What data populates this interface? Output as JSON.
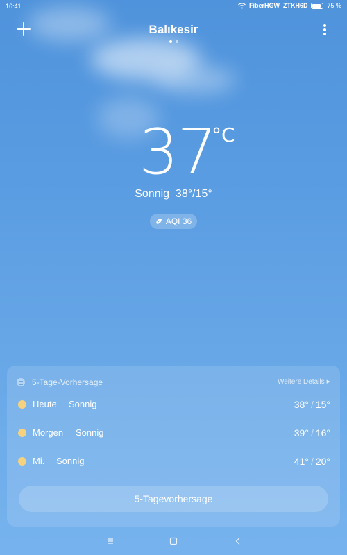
{
  "status_bar": {
    "time": "16:41",
    "network": "FiberHGW_ZTKH6D",
    "battery": "75 %"
  },
  "header": {
    "city": "Balıkesir",
    "pages": 2,
    "active_page": 0
  },
  "current": {
    "temperature": "37",
    "unit": "°C",
    "condition": "Sonnig",
    "high": "38°",
    "low": "15°",
    "aqi_label": "AQI 36"
  },
  "forecast": {
    "title": "5-Tage-Vorhersage",
    "details_link": "Weitere Details",
    "days": [
      {
        "day": "Heute",
        "condition": "Sonnig",
        "high": "38°",
        "low": "15°"
      },
      {
        "day": "Morgen",
        "condition": "Sonnig",
        "high": "39°",
        "low": "16°"
      },
      {
        "day": "Mi.",
        "condition": "Sonnig",
        "high": "41°",
        "low": "20°"
      }
    ],
    "button_label": "5-Tagevorhersage"
  },
  "nav": {
    "menu_icon": "menu-icon",
    "home_icon": "home-icon",
    "back_icon": "back-icon"
  },
  "colors": {
    "sky_top": "#4f93dc",
    "sky_bottom": "#76b3ee",
    "sun": "#f6d27e"
  }
}
